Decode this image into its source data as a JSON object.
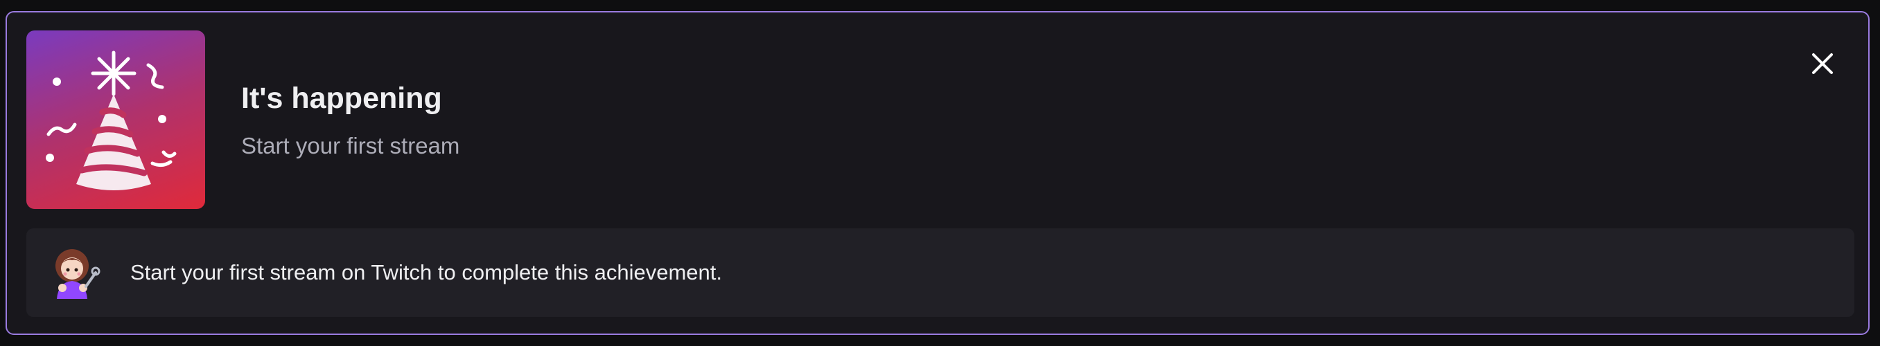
{
  "achievement": {
    "title": "It's happening",
    "subtitle": "Start your first stream",
    "description": "Start your first stream on Twitch to complete this achievement.",
    "badge_icon": "party-hat-icon",
    "avatar_icon": "streamer-avatar-icon",
    "close_icon": "close-icon"
  },
  "colors": {
    "card_background": "#18171c",
    "card_border": "#9a7be0",
    "footer_background": "#212026",
    "badge_gradient_start": "#7a3bbf",
    "badge_gradient_end": "#e02a3a",
    "title_text": "#efeff1",
    "subtitle_text": "#adadb8"
  }
}
